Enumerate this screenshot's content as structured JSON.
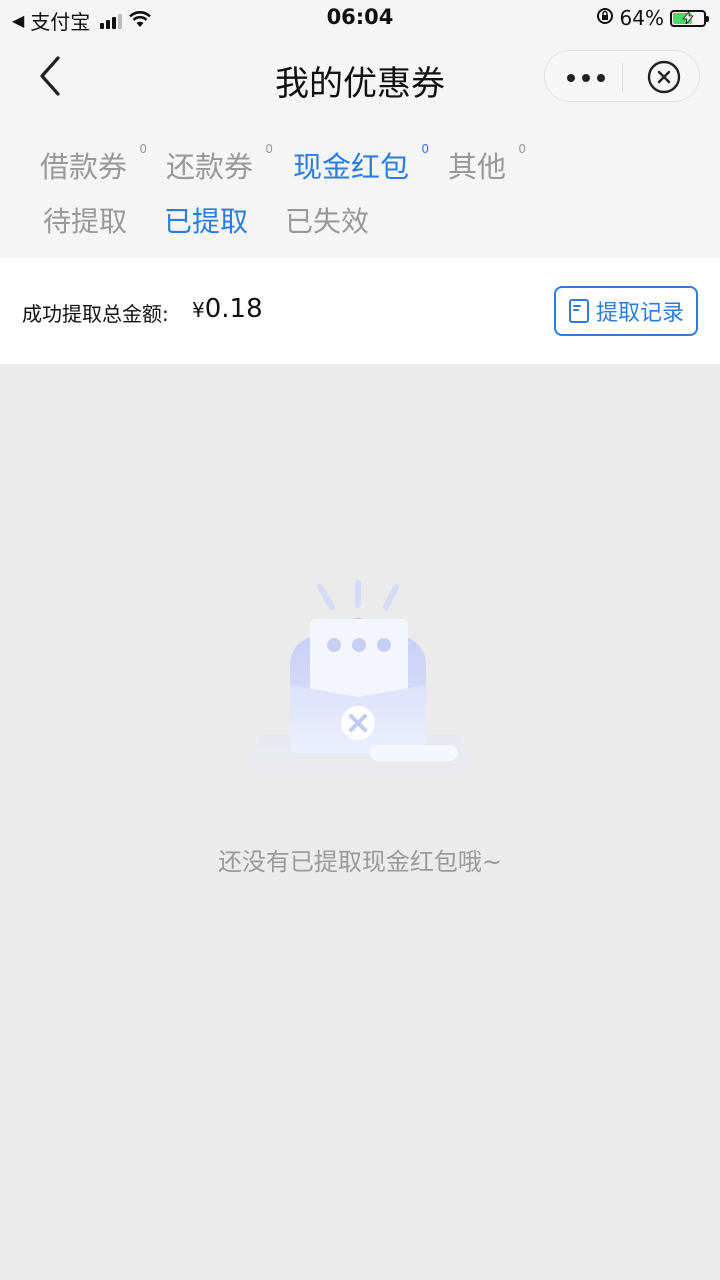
{
  "status_bar": {
    "app_name": "支付宝",
    "time": "06:04",
    "battery_percent": "64%",
    "battery_level": 0.64
  },
  "nav": {
    "title": "我的优惠券"
  },
  "tabs": [
    {
      "label": "借款券",
      "count": "0",
      "active": false
    },
    {
      "label": "还款券",
      "count": "0",
      "active": false
    },
    {
      "label": "现金红包",
      "count": "0",
      "active": true
    },
    {
      "label": "其他",
      "count": "0",
      "active": false
    }
  ],
  "subtabs": [
    {
      "label": "待提取",
      "active": false
    },
    {
      "label": "已提取",
      "active": true
    },
    {
      "label": "已失效",
      "active": false
    }
  ],
  "summary": {
    "label": "成功提取总金额:",
    "currency": "¥",
    "amount": "0.18",
    "record_button": "提取记录"
  },
  "empty_state": {
    "message": "还没有已提取现金红包哦~"
  },
  "colors": {
    "accent": "#2b7de0",
    "muted_text": "#999999",
    "page_bg": "#ebebeb",
    "header_bg": "#f5f5f5"
  }
}
